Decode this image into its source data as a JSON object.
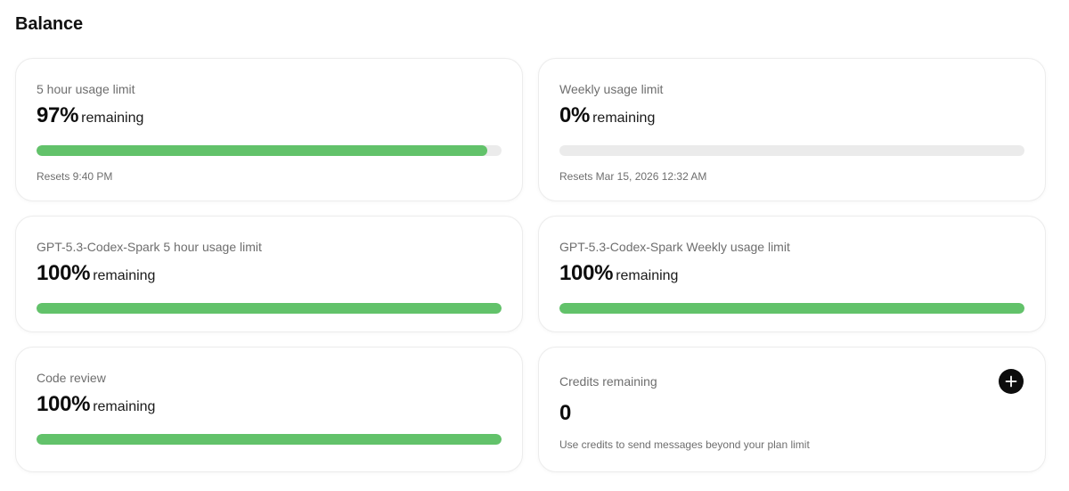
{
  "page": {
    "title": "Balance"
  },
  "colors": {
    "bar_fill": "#62c26a",
    "bar_track": "#ebebeb",
    "text_primary": "#0d0d0d",
    "text_secondary": "#6e6e6e"
  },
  "cards": [
    {
      "label": "5 hour usage limit",
      "value": "97%",
      "suffix": "remaining",
      "progress_percent": 97,
      "footer": "Resets 9:40 PM"
    },
    {
      "label": "Weekly usage limit",
      "value": "0%",
      "suffix": "remaining",
      "progress_percent": 0,
      "footer": "Resets Mar 15, 2026 12:32 AM"
    },
    {
      "label": "GPT-5.3-Codex-Spark 5 hour usage limit",
      "value": "100%",
      "suffix": "remaining",
      "progress_percent": 100
    },
    {
      "label": "GPT-5.3-Codex-Spark Weekly usage limit",
      "value": "100%",
      "suffix": "remaining",
      "progress_percent": 100
    },
    {
      "label": "Code review",
      "value": "100%",
      "suffix": "remaining",
      "progress_percent": 100
    }
  ],
  "credits": {
    "label": "Credits remaining",
    "value": "0",
    "footer": "Use credits to send messages beyond your plan limit",
    "add_icon": "plus-icon"
  }
}
